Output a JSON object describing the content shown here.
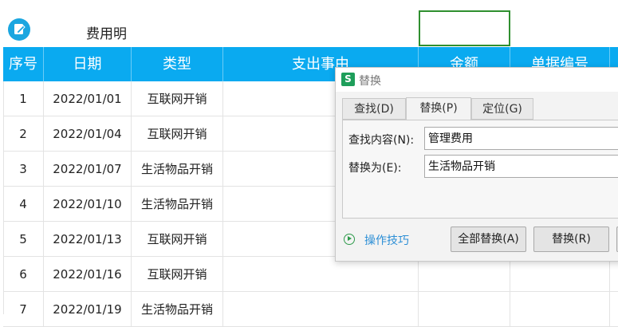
{
  "sheet": {
    "title": "费用明",
    "columns": [
      "序号",
      "日期",
      "类型",
      "支出事由",
      "金额",
      "单据编号"
    ],
    "rows": [
      {
        "no": "1",
        "date": "2022/01/01",
        "type": "互联网开销"
      },
      {
        "no": "2",
        "date": "2022/01/04",
        "type": "互联网开销"
      },
      {
        "no": "3",
        "date": "2022/01/07",
        "type": "生活物品开销"
      },
      {
        "no": "4",
        "date": "2022/01/10",
        "type": "生活物品开销"
      },
      {
        "no": "5",
        "date": "2022/01/13",
        "type": "互联网开销"
      },
      {
        "no": "6",
        "date": "2022/01/16",
        "type": "互联网开销"
      },
      {
        "no": "7",
        "date": "2022/01/19",
        "type": "生活物品开销"
      }
    ],
    "colors": {
      "header_bg": "#0aaaf0",
      "selection": "#2f8f2f"
    }
  },
  "dialog": {
    "title": "替换",
    "app_icon": "S",
    "tabs": [
      "查找(D)",
      "替换(P)",
      "定位(G)"
    ],
    "active_tab": "替换(P)",
    "find_label": "查找内容(N):",
    "find_value": "管理费用",
    "replace_label": "替换为(E):",
    "replace_value": "生活物品开销",
    "tips_label": "操作技巧",
    "replace_all_label": "全部替换(A)",
    "replace_label_btn": "替换(R)"
  }
}
